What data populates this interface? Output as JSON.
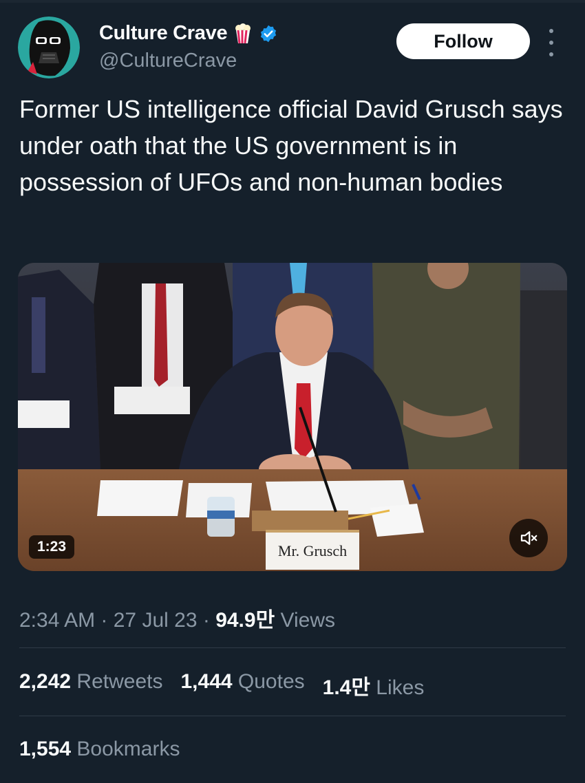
{
  "colors": {
    "background": "#15202b",
    "text": "#f7f9f9",
    "secondary_text": "#8b98a5",
    "verified": "#1d9bf0",
    "follow_button_bg": "#ffffff"
  },
  "author": {
    "name": "Culture Crave",
    "handle": "@CultureCrave",
    "avatar_icon": "darth-vader-avatar",
    "badge_icon": "popcorn-icon",
    "verified_icon": "verified-badge-icon"
  },
  "follow_label": "Follow",
  "tweet": {
    "text": "Former US intelligence official David Grusch says under oath that the US government is in possession of UFOs and non-human bodies"
  },
  "media": {
    "duration": "1:23",
    "nameplate": "Mr. Grusch",
    "mute_icon": "speaker-muted-icon"
  },
  "meta": {
    "time": "2:34 AM",
    "date": "27 Jul 23",
    "views_count": "94.9만",
    "views_label": "Views"
  },
  "stats": {
    "retweets_count": "2,242",
    "retweets_label": "Retweets",
    "quotes_count": "1,444",
    "quotes_label": "Quotes",
    "likes_count": "1.4만",
    "likes_label": "Likes",
    "bookmarks_count": "1,554",
    "bookmarks_label": "Bookmarks"
  }
}
